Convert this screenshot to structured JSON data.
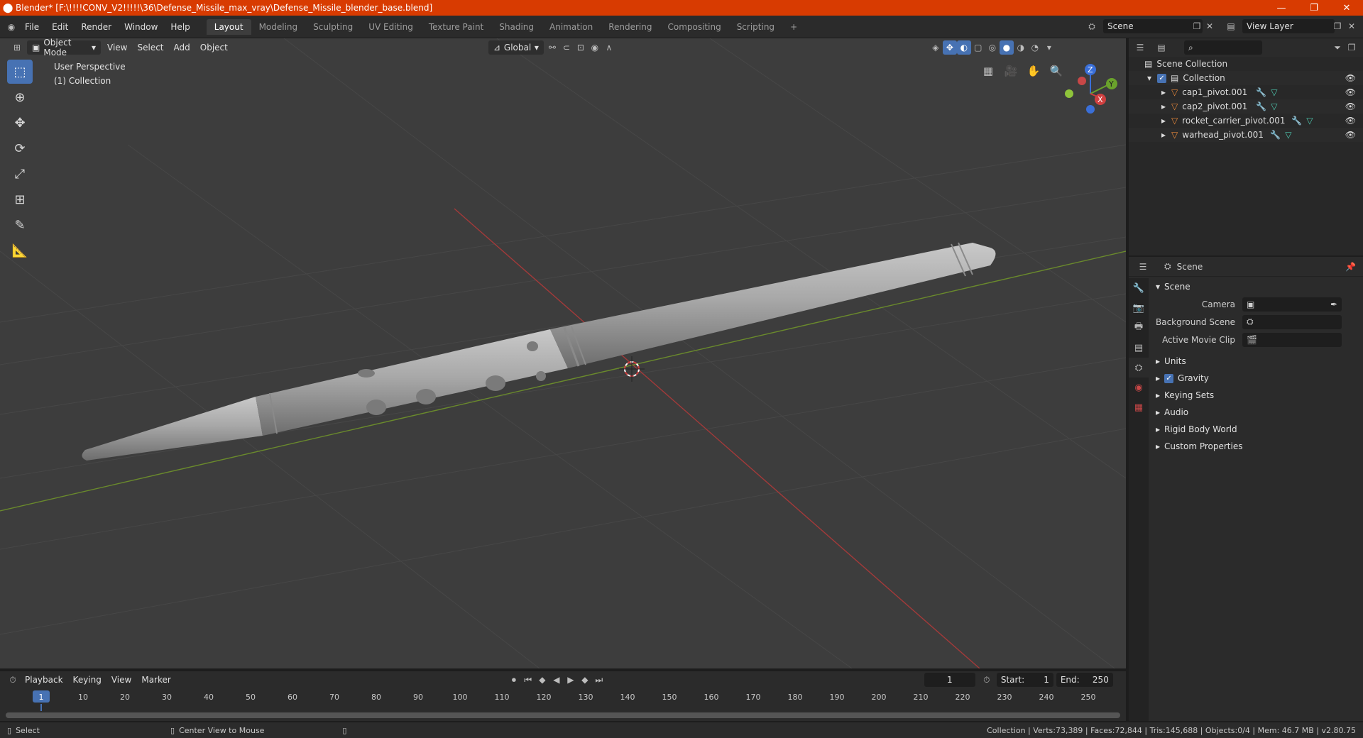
{
  "window": {
    "title": "Blender* [F:\\!!!!CONV_V2!!!!!\\36\\Defense_Missile_max_vray\\Defense_Missile_blender_base.blend]",
    "minimize": "—",
    "restore": "❐",
    "close": "✕"
  },
  "menu": [
    "File",
    "Edit",
    "Render",
    "Window",
    "Help"
  ],
  "workspaces": [
    "Layout",
    "Modeling",
    "Sculpting",
    "UV Editing",
    "Texture Paint",
    "Shading",
    "Animation",
    "Rendering",
    "Compositing",
    "Scripting"
  ],
  "workspace_add": "+",
  "scene_name": "Scene",
  "view_layer_name": "View Layer",
  "viewport_header": {
    "mode": "Object Mode",
    "menus": [
      "View",
      "Select",
      "Add",
      "Object"
    ],
    "orientation": "Global"
  },
  "viewport_info": {
    "perspective": "User Perspective",
    "collection": "(1) Collection"
  },
  "gizmo": {
    "x": "X",
    "y": "Y",
    "z": "Z"
  },
  "outliner": {
    "root": "Scene Collection",
    "collection": "Collection",
    "objects": [
      "cap1_pivot.001",
      "cap2_pivot.001",
      "rocket_carrier_pivot.001",
      "warhead_pivot.001"
    ]
  },
  "properties": {
    "header": "Scene",
    "panel": "Scene",
    "camera_label": "Camera",
    "background_label": "Background Scene",
    "movieclip_label": "Active Movie Clip",
    "subpanels": [
      "Units",
      "Gravity",
      "Keying Sets",
      "Audio",
      "Rigid Body World",
      "Custom Properties"
    ]
  },
  "timeline": {
    "menus": [
      "Playback",
      "Keying",
      "View",
      "Marker"
    ],
    "current_frame": "1",
    "start_label": "Start:",
    "start": "1",
    "end_label": "End:",
    "end": "250",
    "ticks": [
      "1",
      "10",
      "20",
      "30",
      "40",
      "50",
      "60",
      "70",
      "80",
      "90",
      "100",
      "110",
      "120",
      "130",
      "140",
      "150",
      "160",
      "170",
      "180",
      "190",
      "200",
      "210",
      "220",
      "230",
      "240",
      "250"
    ]
  },
  "status": {
    "left1": "Select",
    "left2": "Center View to Mouse",
    "right": "Collection | Verts:73,389 | Faces:72,844 | Tris:145,688 | Objects:0/4 | Mem: 46.7 MB | v2.80.75"
  }
}
